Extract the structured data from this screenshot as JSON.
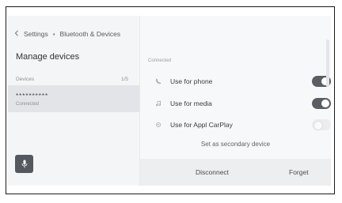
{
  "breadcrumb": {
    "back_icon": "chevron-left-icon",
    "root": "Settings",
    "separator": "•",
    "current": "Bluetooth & Devices"
  },
  "left_panel": {
    "title": "Manage devices",
    "devices_label": "Devices",
    "devices_count": "1/5",
    "device": {
      "name": "**********",
      "status": "Connected"
    },
    "mic_icon": "microphone-icon"
  },
  "right_panel": {
    "section_label": "Connected",
    "options": [
      {
        "label": "Use for phone",
        "icon": "phone-icon",
        "enabled": true
      },
      {
        "label": "Use for media",
        "icon": "music-note-icon",
        "enabled": true
      },
      {
        "label": "Use for Appl CarPlay",
        "icon": "carplay-icon",
        "enabled": false
      }
    ],
    "secondary_action": "Set as secondary device",
    "disconnect_label": "Disconnect",
    "forget_label": "Forget"
  },
  "colors": {
    "toggle_on": "#5a5d62",
    "toggle_off": "#ececee",
    "mic_button": "#55595f"
  }
}
